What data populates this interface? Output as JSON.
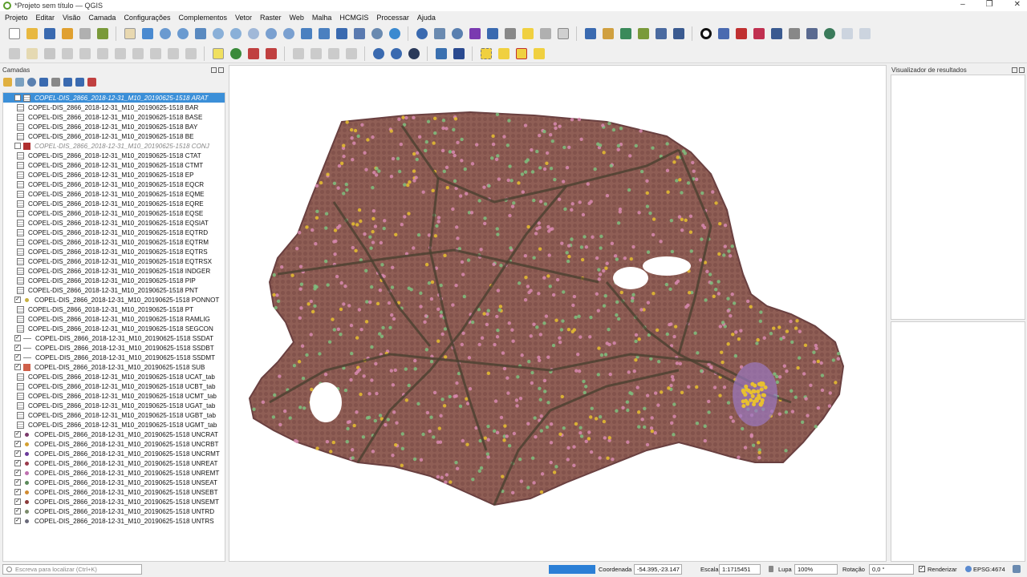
{
  "window": {
    "title": "*Projeto sem título — QGIS"
  },
  "menu": [
    "Projeto",
    "Editar",
    "Visão",
    "Camada",
    "Configurações",
    "Complementos",
    "Vetor",
    "Raster",
    "Web",
    "Malha",
    "HCMGIS",
    "Processar",
    "Ajuda"
  ],
  "layers_panel": {
    "title": "Camadas",
    "items": [
      {
        "label": "COPEL-DIS_2866_2018-12-31_M10_20190625-1518 ARAT",
        "symbol": "table",
        "checked": false,
        "state": "selected"
      },
      {
        "label": "COPEL-DIS_2866_2018-12-31_M10_20190625-1518 BAR",
        "symbol": "table",
        "checked": null,
        "state": ""
      },
      {
        "label": "COPEL-DIS_2866_2018-12-31_M10_20190625-1518 BASE",
        "symbol": "table",
        "checked": null,
        "state": ""
      },
      {
        "label": "COPEL-DIS_2866_2018-12-31_M10_20190625-1518 BAY",
        "symbol": "table",
        "checked": null,
        "state": ""
      },
      {
        "label": "COPEL-DIS_2866_2018-12-31_M10_20190625-1518 BE",
        "symbol": "table",
        "checked": null,
        "state": ""
      },
      {
        "label": "COPEL-DIS_2866_2018-12-31_M10_20190625-1518 CONJ",
        "symbol": "fill",
        "color": "#b03030",
        "checked": false,
        "state": "grey"
      },
      {
        "label": "COPEL-DIS_2866_2018-12-31_M10_20190625-1518 CTAT",
        "symbol": "table",
        "checked": null,
        "state": ""
      },
      {
        "label": "COPEL-DIS_2866_2018-12-31_M10_20190625-1518 CTMT",
        "symbol": "table",
        "checked": null,
        "state": ""
      },
      {
        "label": "COPEL-DIS_2866_2018-12-31_M10_20190625-1518 EP",
        "symbol": "table",
        "checked": null,
        "state": ""
      },
      {
        "label": "COPEL-DIS_2866_2018-12-31_M10_20190625-1518 EQCR",
        "symbol": "table",
        "checked": null,
        "state": ""
      },
      {
        "label": "COPEL-DIS_2866_2018-12-31_M10_20190625-1518 EQME",
        "symbol": "table",
        "checked": null,
        "state": ""
      },
      {
        "label": "COPEL-DIS_2866_2018-12-31_M10_20190625-1518 EQRE",
        "symbol": "table",
        "checked": null,
        "state": ""
      },
      {
        "label": "COPEL-DIS_2866_2018-12-31_M10_20190625-1518 EQSE",
        "symbol": "table",
        "checked": null,
        "state": ""
      },
      {
        "label": "COPEL-DIS_2866_2018-12-31_M10_20190625-1518 EQSIAT",
        "symbol": "table",
        "checked": null,
        "state": ""
      },
      {
        "label": "COPEL-DIS_2866_2018-12-31_M10_20190625-1518 EQTRD",
        "symbol": "table",
        "checked": null,
        "state": ""
      },
      {
        "label": "COPEL-DIS_2866_2018-12-31_M10_20190625-1518 EQTRM",
        "symbol": "table",
        "checked": null,
        "state": ""
      },
      {
        "label": "COPEL-DIS_2866_2018-12-31_M10_20190625-1518 EQTRS",
        "symbol": "table",
        "checked": null,
        "state": ""
      },
      {
        "label": "COPEL-DIS_2866_2018-12-31_M10_20190625-1518 EQTRSX",
        "symbol": "table",
        "checked": null,
        "state": ""
      },
      {
        "label": "COPEL-DIS_2866_2018-12-31_M10_20190625-1518 INDGER",
        "symbol": "table",
        "checked": null,
        "state": ""
      },
      {
        "label": "COPEL-DIS_2866_2018-12-31_M10_20190625-1518 PIP",
        "symbol": "table",
        "checked": null,
        "state": ""
      },
      {
        "label": "COPEL-DIS_2866_2018-12-31_M10_20190625-1518 PNT",
        "symbol": "table",
        "checked": null,
        "state": ""
      },
      {
        "label": "COPEL-DIS_2866_2018-12-31_M10_20190625-1518 PONNOT",
        "symbol": "point",
        "color": "#c8b040",
        "checked": true,
        "state": ""
      },
      {
        "label": "COPEL-DIS_2866_2018-12-31_M10_20190625-1518 PT",
        "symbol": "table",
        "checked": null,
        "state": ""
      },
      {
        "label": "COPEL-DIS_2866_2018-12-31_M10_20190625-1518 RAMLIG",
        "symbol": "table",
        "checked": null,
        "state": ""
      },
      {
        "label": "COPEL-DIS_2866_2018-12-31_M10_20190625-1518 SEGCON",
        "symbol": "table",
        "checked": null,
        "state": ""
      },
      {
        "label": "COPEL-DIS_2866_2018-12-31_M10_20190625-1518 SSDAT",
        "symbol": "line",
        "checked": true,
        "state": ""
      },
      {
        "label": "COPEL-DIS_2866_2018-12-31_M10_20190625-1518 SSDBT",
        "symbol": "line",
        "checked": true,
        "state": ""
      },
      {
        "label": "COPEL-DIS_2866_2018-12-31_M10_20190625-1518 SSDMT",
        "symbol": "line",
        "checked": true,
        "state": ""
      },
      {
        "label": "COPEL-DIS_2866_2018-12-31_M10_20190625-1518 SUB",
        "symbol": "fill",
        "color": "#d0604a",
        "checked": true,
        "state": ""
      },
      {
        "label": "COPEL-DIS_2866_2018-12-31_M10_20190625-1518 UCAT_tab",
        "symbol": "table",
        "checked": null,
        "state": ""
      },
      {
        "label": "COPEL-DIS_2866_2018-12-31_M10_20190625-1518 UCBT_tab",
        "symbol": "table",
        "checked": null,
        "state": ""
      },
      {
        "label": "COPEL-DIS_2866_2018-12-31_M10_20190625-1518 UCMT_tab",
        "symbol": "table",
        "checked": null,
        "state": ""
      },
      {
        "label": "COPEL-DIS_2866_2018-12-31_M10_20190625-1518 UGAT_tab",
        "symbol": "table",
        "checked": null,
        "state": ""
      },
      {
        "label": "COPEL-DIS_2866_2018-12-31_M10_20190625-1518 UGBT_tab",
        "symbol": "table",
        "checked": null,
        "state": ""
      },
      {
        "label": "COPEL-DIS_2866_2018-12-31_M10_20190625-1518 UGMT_tab",
        "symbol": "table",
        "checked": null,
        "state": ""
      },
      {
        "label": "COPEL-DIS_2866_2018-12-31_M10_20190625-1518 UNCRAT",
        "symbol": "point",
        "color": "#7a3a6a",
        "checked": true,
        "state": ""
      },
      {
        "label": "COPEL-DIS_2866_2018-12-31_M10_20190625-1518 UNCRBT",
        "symbol": "point",
        "color": "#d4a030",
        "checked": true,
        "state": ""
      },
      {
        "label": "COPEL-DIS_2866_2018-12-31_M10_20190625-1518 UNCRMT",
        "symbol": "point",
        "color": "#6a3a9a",
        "checked": true,
        "state": ""
      },
      {
        "label": "COPEL-DIS_2866_2018-12-31_M10_20190625-1518 UNREAT",
        "symbol": "point",
        "color": "#9a3a4a",
        "checked": true,
        "state": ""
      },
      {
        "label": "COPEL-DIS_2866_2018-12-31_M10_20190625-1518 UNREMT",
        "symbol": "point",
        "color": "#c070b0",
        "checked": true,
        "state": ""
      },
      {
        "label": "COPEL-DIS_2866_2018-12-31_M10_20190625-1518 UNSEAT",
        "symbol": "point",
        "color": "#5a8a5a",
        "checked": true,
        "state": ""
      },
      {
        "label": "COPEL-DIS_2866_2018-12-31_M10_20190625-1518 UNSEBT",
        "symbol": "point",
        "color": "#d08a30",
        "checked": true,
        "state": ""
      },
      {
        "label": "COPEL-DIS_2866_2018-12-31_M10_20190625-1518 UNSEMT",
        "symbol": "point",
        "color": "#8a3a3a",
        "checked": true,
        "state": ""
      },
      {
        "label": "COPEL-DIS_2866_2018-12-31_M10_20190625-1518 UNTRD",
        "symbol": "point",
        "color": "#7a8a6a",
        "checked": true,
        "state": ""
      },
      {
        "label": "COPEL-DIS_2866_2018-12-31_M10_20190625-1518 UNTRS",
        "symbol": "point",
        "color": "#6a6a7a",
        "checked": true,
        "state": ""
      }
    ]
  },
  "results_panel": {
    "title": "Visualizador de resultados"
  },
  "map_colors": {
    "fill": "#8f5e55",
    "lines": "#4a4030",
    "pink": "#d889b0",
    "green": "#7fc07f",
    "yellow": "#e8c030",
    "purple": "#9a78c0"
  },
  "statusbar": {
    "locator_placeholder": "Escreva para localizar (Ctrl+K)",
    "coord_label": "Coordenada",
    "coord_value": "-54.395,-23.147",
    "scale_label": "Escala",
    "scale_value": "1:1715451",
    "lupa_label": "Lupa",
    "lupa_value": "100%",
    "rotation_label": "Rotação",
    "rotation_value": "0,0 °",
    "render_label": "Renderizar",
    "crs_label": "EPSG:4674"
  }
}
